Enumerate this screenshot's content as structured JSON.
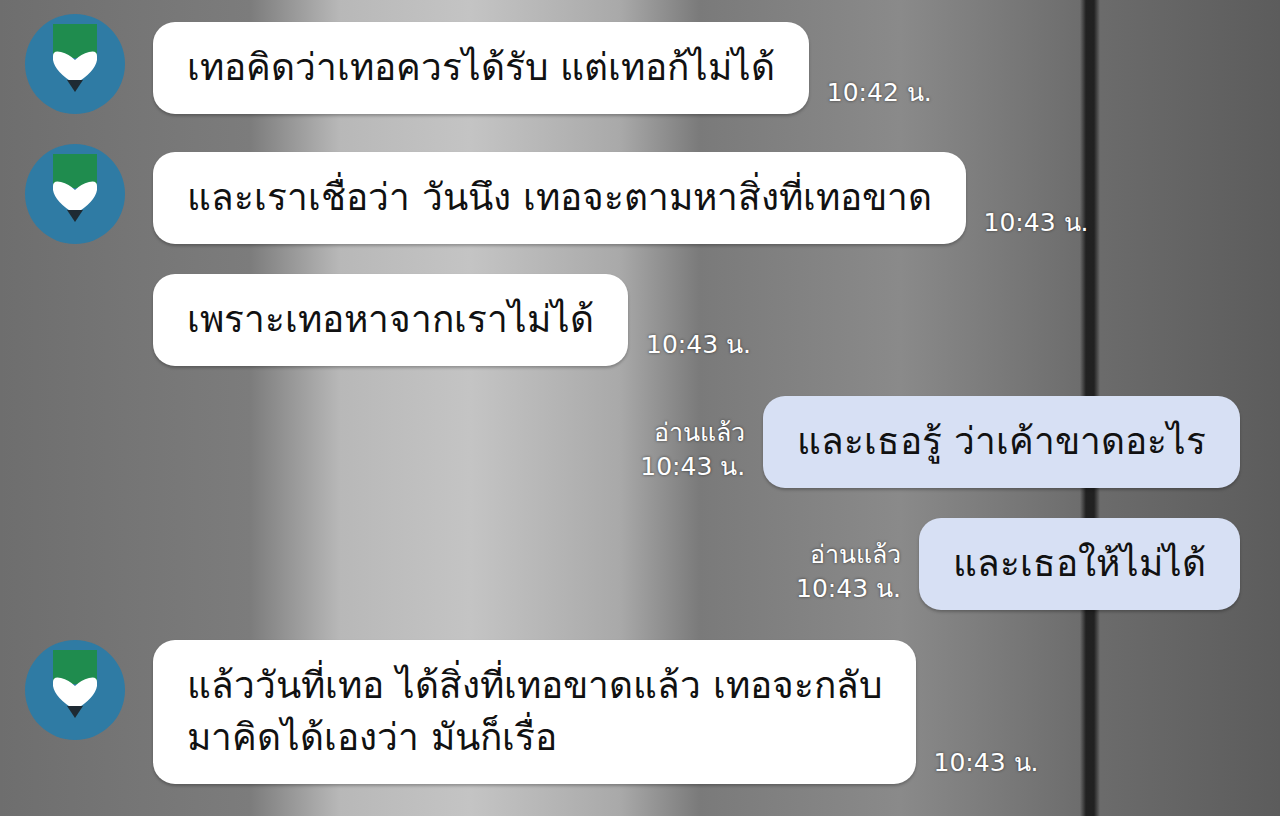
{
  "messages": [
    {
      "kind": "incoming",
      "show_avatar": true,
      "text": "เทอคิดว่าเทอควรได้รับ แต่เทอก้ไม่ได้",
      "time": "10:42 น."
    },
    {
      "kind": "incoming",
      "show_avatar": true,
      "text": "และเราเชื่อว่า วันนึง เทอจะตามหาสิ่งที่เทอขาด",
      "time": "10:43 น."
    },
    {
      "kind": "incoming",
      "show_avatar": false,
      "text": "เพราะเทอหาจากเราไม่ได้",
      "time": "10:43 น."
    },
    {
      "kind": "outgoing",
      "read_label": "อ่านแล้ว",
      "text": "และเธอรู้ ว่าเค้าขาดอะไร",
      "time": "10:43 น."
    },
    {
      "kind": "outgoing",
      "read_label": "อ่านแล้ว",
      "text": "และเธอให้ไม่ได้",
      "time": "10:43 น."
    },
    {
      "kind": "incoming",
      "show_avatar": true,
      "text": "แล้ววันที่เทอ ได้สิ่งที่เทอขาดแล้ว เทอจะกลับ\nมาคิดได้เองว่า มันก็เรื่อ",
      "time": "10:43 น."
    }
  ]
}
